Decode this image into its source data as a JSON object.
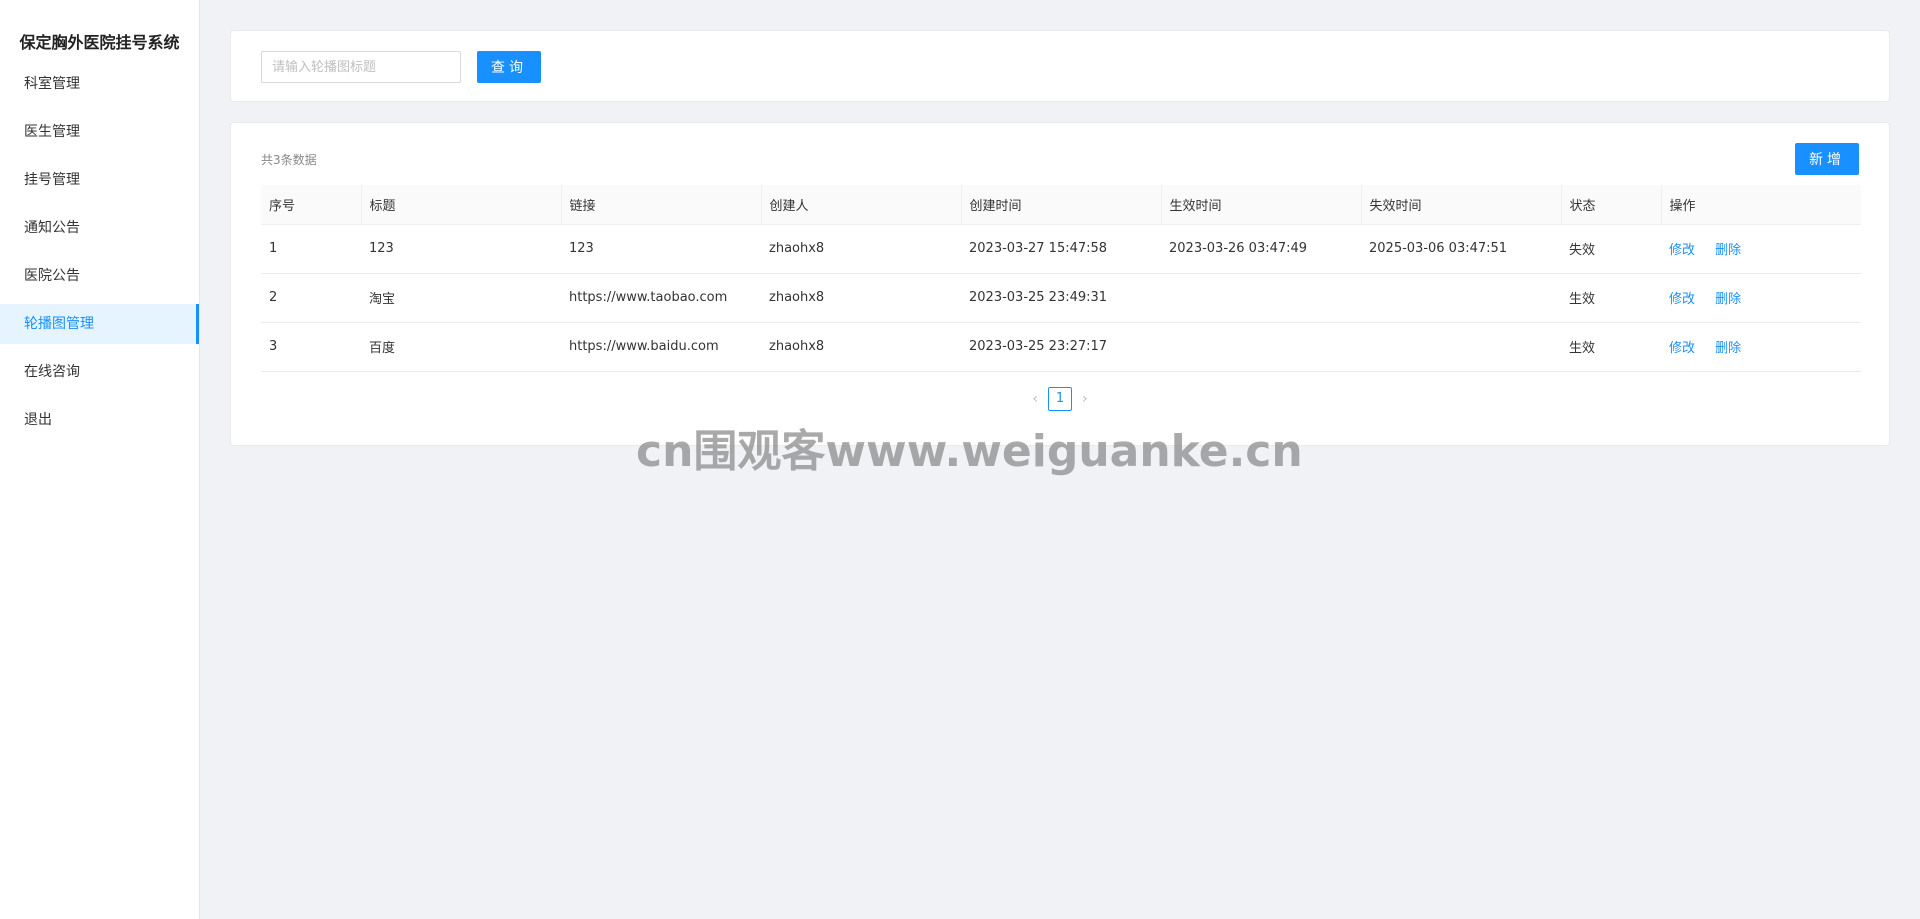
{
  "app": {
    "title": "保定胸外医院挂号系统"
  },
  "sidebar": {
    "items": [
      {
        "label": "科室管理",
        "active": false
      },
      {
        "label": "医生管理",
        "active": false
      },
      {
        "label": "挂号管理",
        "active": false
      },
      {
        "label": "通知公告",
        "active": false
      },
      {
        "label": "医院公告",
        "active": false
      },
      {
        "label": "轮播图管理",
        "active": true
      },
      {
        "label": "在线咨询",
        "active": false
      },
      {
        "label": "退出",
        "active": false
      }
    ]
  },
  "search": {
    "placeholder": "请输入轮播图标题",
    "value": "",
    "button_label": "查询"
  },
  "table": {
    "count_text": "共3条数据",
    "add_label": "新增",
    "columns": [
      "序号",
      "标题",
      "链接",
      "创建人",
      "创建时间",
      "生效时间",
      "失效时间",
      "状态",
      "操作"
    ],
    "rows": [
      {
        "index": "1",
        "title": "123",
        "link": "123",
        "creator": "zhaohx8",
        "created": "2023-03-27 15:47:58",
        "effective": "2023-03-26 03:47:49",
        "expire": "2025-03-06 03:47:51",
        "status": "失效",
        "edit": "修改",
        "delete": "删除"
      },
      {
        "index": "2",
        "title": "淘宝",
        "link": "https://www.taobao.com",
        "creator": "zhaohx8",
        "created": "2023-03-25 23:49:31",
        "effective": "",
        "expire": "",
        "status": "生效",
        "edit": "修改",
        "delete": "删除"
      },
      {
        "index": "3",
        "title": "百度",
        "link": "https://www.baidu.com",
        "creator": "zhaohx8",
        "created": "2023-03-25 23:27:17",
        "effective": "",
        "expire": "",
        "status": "生效",
        "edit": "修改",
        "delete": "删除"
      }
    ]
  },
  "pagination": {
    "prev": "‹",
    "current": "1",
    "next": "›"
  },
  "watermark": "cn围观客www.weiguanke.cn",
  "colors": {
    "primary": "#1890ff",
    "background": "#f0f2f5",
    "sidebar_active_bg": "#e6f4ff"
  }
}
